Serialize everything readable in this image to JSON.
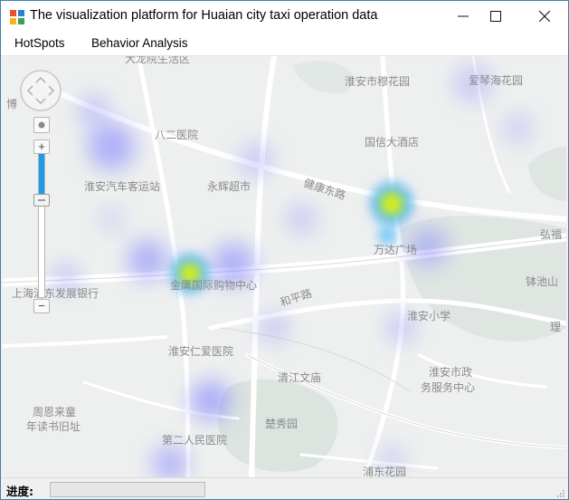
{
  "window": {
    "title": "The visualization platform for Huaian city taxi operation data",
    "minimize_icon": "minimize-icon",
    "maximize_icon": "maximize-icon",
    "close_icon": "close-icon"
  },
  "menu": {
    "items": [
      "HotSpots",
      "Behavior Analysis"
    ]
  },
  "map": {
    "labels": {
      "top_cut": "大龙院生活区",
      "left_cut": "博",
      "mu_hua": "淮安市穆花园",
      "aiqin": "爱琴海花园",
      "bayi": "八二医院",
      "guoxin": "国信大酒店",
      "bus_station": "淮安汽车客运站",
      "yonghui": "永辉超市",
      "jiankang_rd": "健康东路",
      "hongfu": "弘福",
      "wanda": "万达广场",
      "pudong_bank": "上海浦东发展银行",
      "jinying": "金鹰国际购物中心",
      "heping_rd": "和平路",
      "zhuchi": "钵池山",
      "primary_school": "淮安小学",
      "renai": "淮安仁爱医院",
      "qingjiang": "清江文庙",
      "gov_center_1": "淮安市政",
      "gov_center_2": "务服务中心",
      "zhou_1": "周恩来童",
      "zhou_2": "年读书旧址",
      "chuxiu": "楚秀园",
      "second_hospital": "第二人民医院",
      "pudong_garden": "浦东花园",
      "edge_li": "理"
    },
    "nav_icon": "pan-control-icon",
    "zoom": {
      "in_label": "+",
      "out_label": "−",
      "level_fraction": 0.68
    },
    "heat_colors": {
      "low": "#7b7bff",
      "mid": "#1db5ff",
      "high": "#f6e600"
    }
  },
  "status": {
    "label": "进度:",
    "progress_fraction": 0
  }
}
